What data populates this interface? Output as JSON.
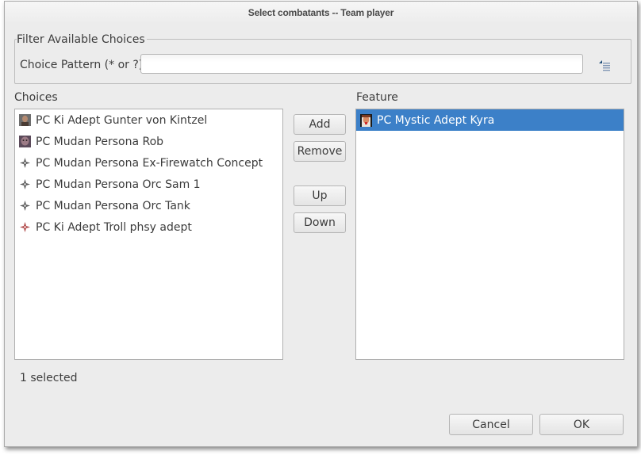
{
  "window": {
    "title": "Select combatants -- Team player"
  },
  "filter": {
    "group_title": "Filter Available Choices",
    "pattern_label": "Choice Pattern (* or ?)",
    "pattern_value": "",
    "pattern_placeholder": "",
    "filter_icon": "list-indent-icon"
  },
  "choices": {
    "label": "Choices",
    "items": [
      {
        "label": "PC Ki Adept Gunter von Kintzel",
        "icon": "portrait-icon"
      },
      {
        "label": "PC Mudan Persona Rob",
        "icon": "portrait-icon"
      },
      {
        "label": "PC Mudan Persona Ex-Firewatch Concept",
        "icon": "compass-star-icon"
      },
      {
        "label": "PC Mudan Persona Orc Sam 1",
        "icon": "compass-star-icon"
      },
      {
        "label": "PC Mudan Persona Orc Tank",
        "icon": "compass-star-icon"
      },
      {
        "label": "PC Ki Adept Troll phsy adept",
        "icon": "compass-star-red-icon"
      }
    ]
  },
  "actions": {
    "add": "Add",
    "remove": "Remove",
    "up": "Up",
    "down": "Down"
  },
  "feature": {
    "label": "Feature",
    "items": [
      {
        "label": "PC Mystic Adept Kyra",
        "icon": "portrait-icon",
        "selected": true
      }
    ]
  },
  "status": {
    "text": "1 selected"
  },
  "footer": {
    "cancel": "Cancel",
    "ok": "OK"
  },
  "colors": {
    "selection": "#3c80c8",
    "dialog_bg": "#ececec"
  }
}
